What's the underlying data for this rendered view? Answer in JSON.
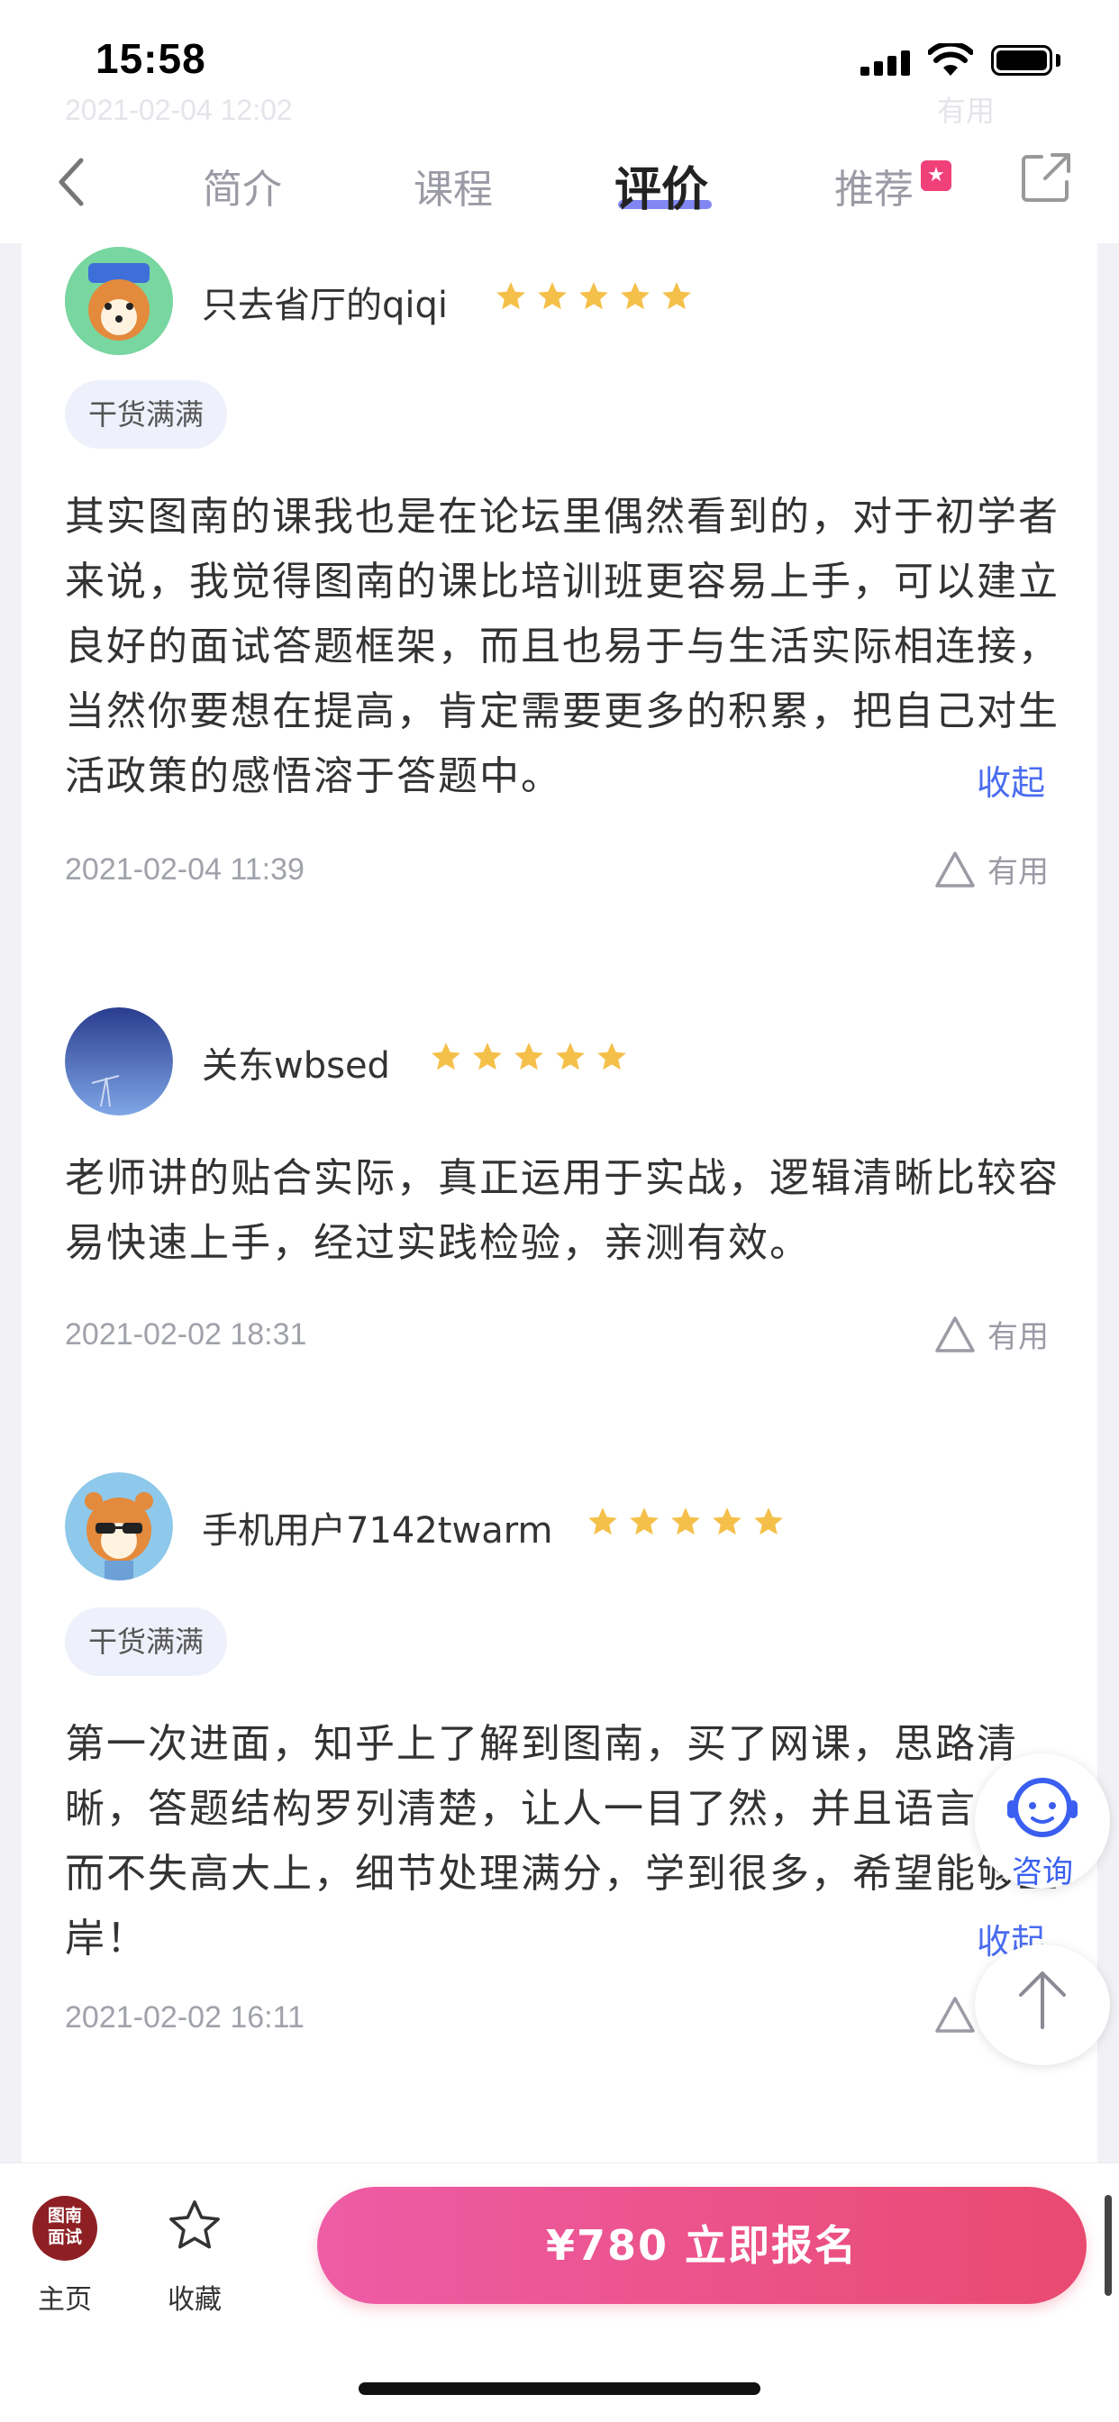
{
  "status_bar": {
    "time": "15:58"
  },
  "ghost": {
    "date": "2021-02-04 12:02",
    "useful": "有用"
  },
  "nav": {
    "tabs": [
      {
        "label": "简介"
      },
      {
        "label": "课程"
      },
      {
        "label": "评价",
        "active": true
      },
      {
        "label": "推荐"
      }
    ],
    "accent_color": "#6a72f0"
  },
  "reviews": [
    {
      "username": "只去省厅的qiqi",
      "rating": 5,
      "tag": "干货满满",
      "text": "其实图南的课我也是在论坛里偶然看到的，对于初学者来说，我觉得图南的课比培训班更容易上手，可以建立良好的面试答题框架，而且也易于与生活实际相连接，当然你要想在提高，肯定需要更多的积累，把自己对生活政策的感悟溶于答题中。",
      "collapse": "收起",
      "date": "2021-02-04 11:39",
      "useful": "有用"
    },
    {
      "username": "关东wbsed",
      "rating": 5,
      "text": "老师讲的贴合实际，真正运用于实战，逻辑清晰比较容易快速上手，经过实践检验，亲测有效。",
      "date": "2021-02-02 18:31",
      "useful": "有用"
    },
    {
      "username": "手机用户7142twarm",
      "rating": 5,
      "tag": "干货满满",
      "text": "第一次进面，知乎上了解到图南，买了网课，思路清晰，答题结构罗列清楚，让人一目了然，并且语言亲切而不失高大上，细节处理满分，学到很多，希望能够上岸！",
      "collapse": "收起",
      "date": "2021-02-02 16:11"
    }
  ],
  "floating": {
    "consult_label": "咨询"
  },
  "bottom_bar": {
    "logo_text": "图南面试",
    "home_label": "主页",
    "favorite_label": "收藏",
    "enroll_label": "¥780 立即报名"
  },
  "colors": {
    "star": "#f5c04a",
    "link": "#4a6cf0",
    "enroll_start": "#ee5ca6",
    "enroll_end": "#e94a70"
  }
}
